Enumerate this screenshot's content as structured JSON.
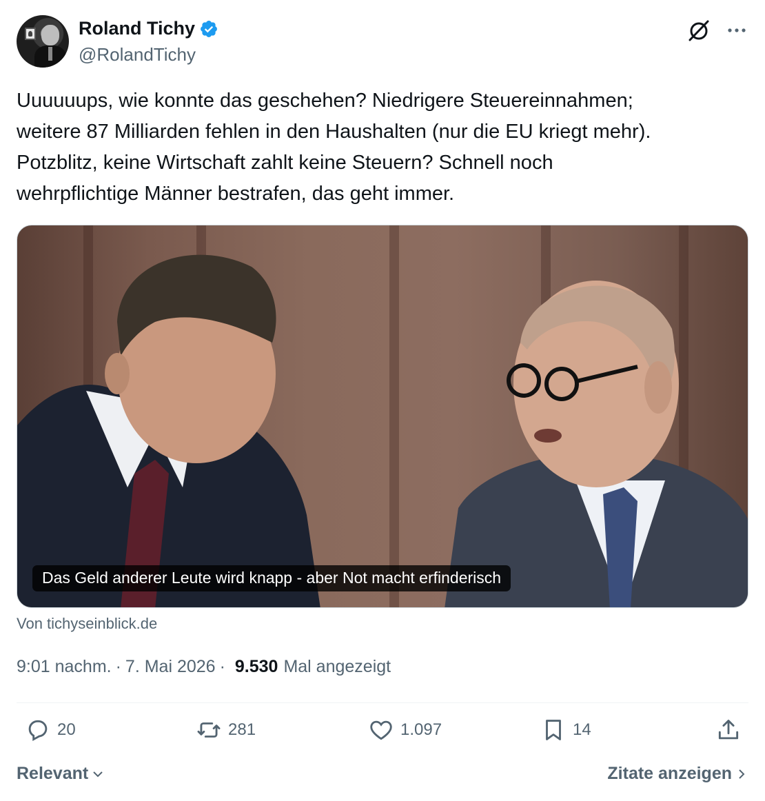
{
  "author": {
    "display_name": "Roland Tichy",
    "handle": "@RolandTichy",
    "verified_color": "#1d9bf0"
  },
  "tweet": {
    "text": "Uuuuuups, wie konnte das geschehen? Niedrigere Steuereinnahmen;\nweitere 87 Milliarden fehlen in den Haushalten (nur die EU kriegt mehr).\nPotzblitz, keine Wirtschaft zahlt keine Steuern? Schnell noch\nwehrpflichtige Männer bestrafen, das geht immer."
  },
  "card": {
    "caption": "Das Geld anderer Leute wird knapp - aber Not macht erfinderisch",
    "source": "Von tichyseinblick.de"
  },
  "meta": {
    "time": "9:01 nachm.",
    "separator": "·",
    "date": "7. Mai 2026",
    "views_count": "9.530",
    "views_label": "Mal angezeigt"
  },
  "actions": {
    "replies": "20",
    "reposts": "281",
    "likes": "1.097",
    "bookmarks": "14"
  },
  "footer": {
    "sort_label": "Relevant",
    "quotes_label": "Zitate anzeigen"
  },
  "icons": {
    "top_right": [
      "grok-icon",
      "more-icon"
    ],
    "actions": [
      "reply-icon",
      "repost-icon",
      "like-icon",
      "bookmark-icon",
      "share-icon"
    ]
  },
  "colors": {
    "text": "#0f1419",
    "secondary": "#536471",
    "divider": "#eff3f4"
  }
}
